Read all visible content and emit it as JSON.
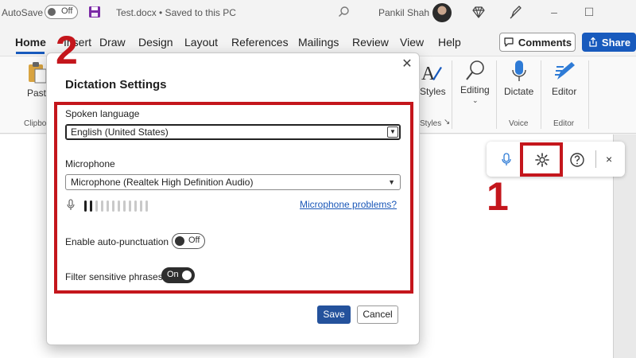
{
  "titlebar": {
    "autosave_label": "AutoSave",
    "autosave_state": "Off",
    "document_title": "Test.docx • Saved to this PC",
    "user_name": "Pankil Shah",
    "icons": [
      "save-icon",
      "search-icon",
      "diamond-icon",
      "pen-icon",
      "minimize-icon",
      "maximize-icon"
    ]
  },
  "tabs": [
    {
      "label": "Home",
      "active": true
    },
    {
      "label": "Insert"
    },
    {
      "label": "Draw"
    },
    {
      "label": "Design"
    },
    {
      "label": "Layout"
    },
    {
      "label": "References"
    },
    {
      "label": "Mailings"
    },
    {
      "label": "Review"
    },
    {
      "label": "View"
    },
    {
      "label": "Help"
    }
  ],
  "actions": {
    "comments_label": "Comments",
    "share_label": "Share"
  },
  "ribbon": {
    "paste_label": "Paste",
    "clipboard_group": "Clipbo",
    "styles_label": "Styles",
    "styles_group": "Styles",
    "editing_label": "Editing",
    "dictate_label": "Dictate",
    "voice_group": "Voice",
    "editor_label": "Editor",
    "editor_group": "Editor"
  },
  "dialog": {
    "title": "Dictation Settings",
    "spoken_language_label": "Spoken language",
    "spoken_language_value": "English (United States)",
    "microphone_label": "Microphone",
    "microphone_value": "Microphone (Realtek High Definition Audio)",
    "mic_level_active_bars": 2,
    "mic_level_total_bars": 12,
    "mic_problems_link": "Microphone problems?",
    "auto_punctuation_label": "Enable auto-punctuation",
    "auto_punctuation_state": "Off",
    "filter_label": "Filter sensitive phrases",
    "filter_state": "On",
    "save_label": "Save",
    "cancel_label": "Cancel"
  },
  "annotations": {
    "step1": "1",
    "step2": "2",
    "color": "#c4161c"
  },
  "colors": {
    "accent": "#185abd",
    "save_button": "#24529c"
  }
}
